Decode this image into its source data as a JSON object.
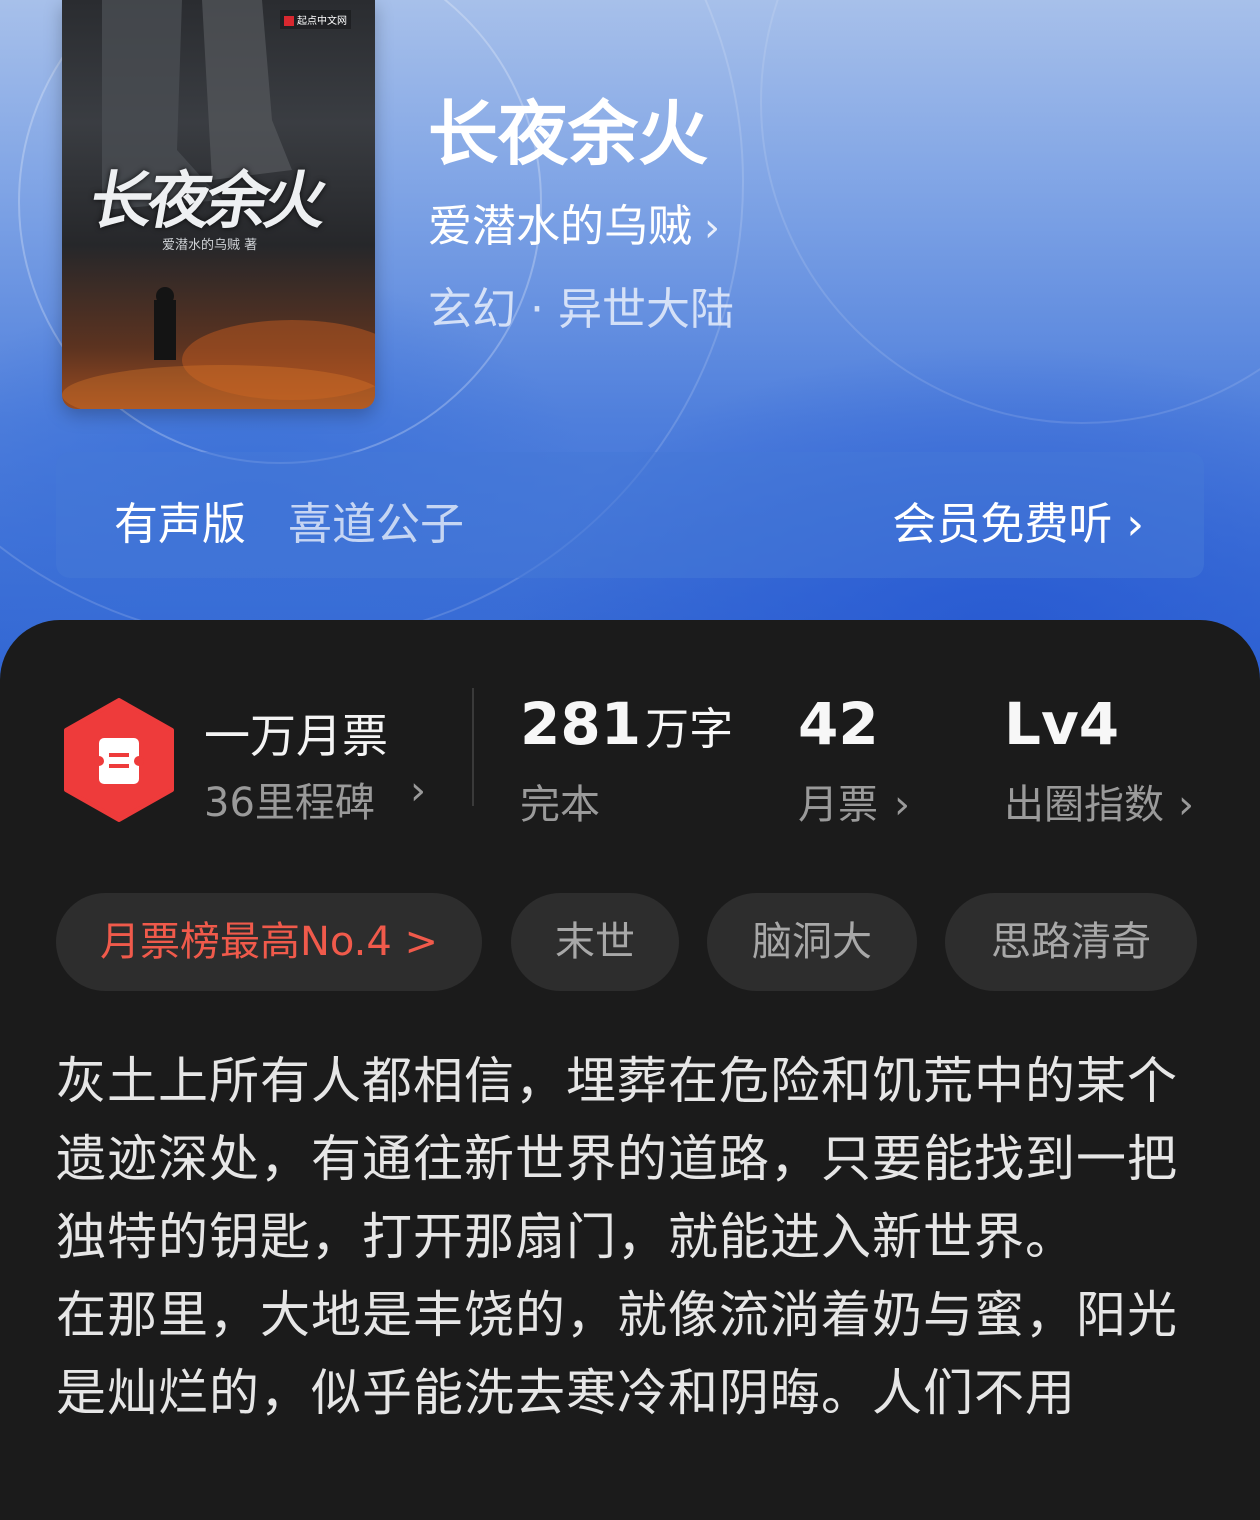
{
  "cover": {
    "title_art": "长夜余火",
    "author_art": "爱潜水的乌贼 著",
    "publisher_badge": "起点中文网"
  },
  "book": {
    "title": "长夜余火",
    "author": "爱潜水的乌贼",
    "genre": "玄幻 · 异世大陆"
  },
  "audio": {
    "label": "有声版",
    "narrator": "喜道公子",
    "cta": "会员免费听"
  },
  "milestone": {
    "title": "一万月票",
    "subtitle": "36里程碑"
  },
  "stats": [
    {
      "value": "281",
      "unit": "万字",
      "label": "完本"
    },
    {
      "value": "42",
      "unit": "",
      "label": "月票"
    },
    {
      "value": "Lv4",
      "unit": "",
      "label": "出圈指数"
    }
  ],
  "tags": {
    "rank": "月票榜最高No.4 >",
    "items": [
      "末世",
      "脑洞大",
      "思路清奇"
    ]
  },
  "synopsis": {
    "para1": "灰土上所有人都相信，埋葬在危险和饥荒中的某个遗迹深处，有通往新世界的道路，只要能找到一把独特的钥匙，打开那扇门，就能进入新世界。",
    "para2": "在那里，大地是丰饶的，就像流淌着奶与蜜，阳光是灿烂的，似乎能洗去寒冷和阴晦。人们不用"
  },
  "colors": {
    "accent_red": "#f05a4b",
    "hero_blue": "#3a6fd6",
    "card_bg": "#1b1b1b"
  }
}
